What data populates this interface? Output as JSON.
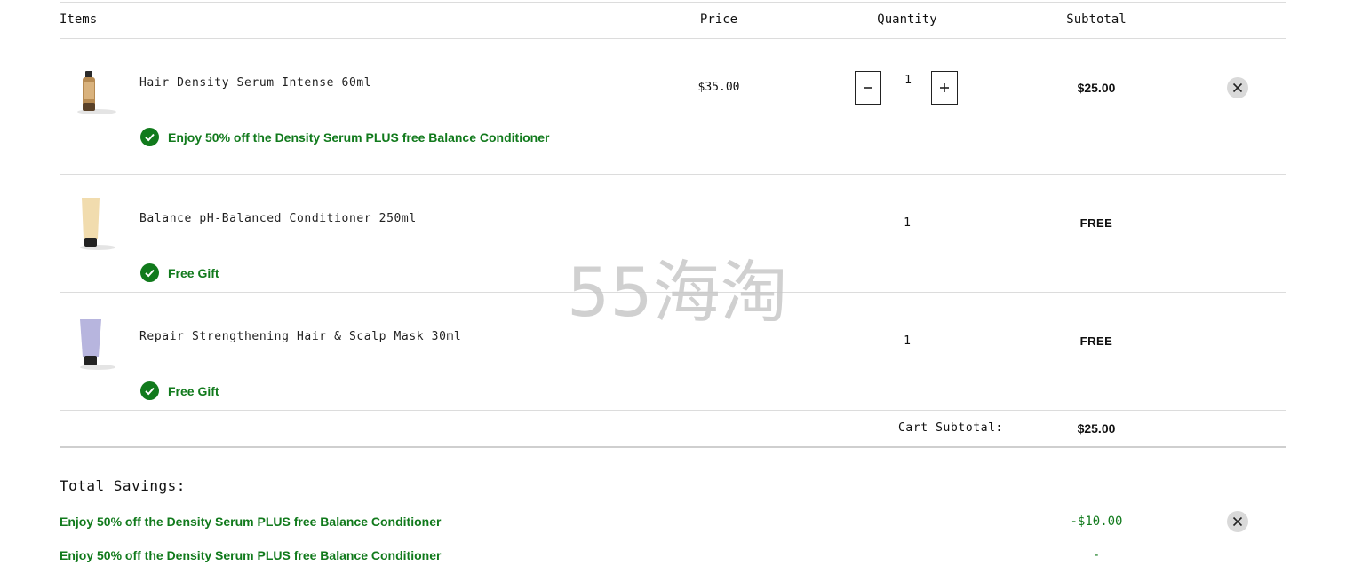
{
  "header": {
    "items": "Items",
    "price": "Price",
    "quantity": "Quantity",
    "subtotal": "Subtotal"
  },
  "items": [
    {
      "name": "Hair Density Serum Intense 60ml",
      "price": "$35.00",
      "quantity": "1",
      "subtotal": "$25.00",
      "promo": "Enjoy 50% off the Density Serum PLUS free Balance Conditioner",
      "image_icon": "amber-serum-bottle-icon"
    },
    {
      "name": "Balance pH-Balanced Conditioner 250ml",
      "quantity": "1",
      "subtotal": "FREE",
      "promo": "Free Gift",
      "image_icon": "cream-tube-icon"
    },
    {
      "name": "Repair Strengthening Hair & Scalp Mask 30ml",
      "quantity": "1",
      "subtotal": "FREE",
      "promo": "Free Gift",
      "image_icon": "lavender-tube-icon"
    }
  ],
  "cart_subtotal": {
    "label": "Cart Subtotal:",
    "value": "$25.00"
  },
  "savings": {
    "title": "Total Savings:",
    "rows": [
      {
        "label": "Enjoy 50% off the Density Serum PLUS free Balance Conditioner",
        "value": "-$10.00"
      },
      {
        "label": "Enjoy 50% off the Density Serum PLUS free Balance Conditioner",
        "value": "-"
      }
    ]
  },
  "watermark": {
    "text": "55海淘"
  },
  "colors": {
    "promo_green": "#117a1c",
    "divider": "#dcdcdc",
    "remove_bg": "#d9d9d9",
    "watermark": "#c8c8c8"
  },
  "icons": {
    "decrease": "minus-icon",
    "increase": "plus-icon",
    "remove": "close-icon",
    "promo": "check-circle-icon"
  }
}
